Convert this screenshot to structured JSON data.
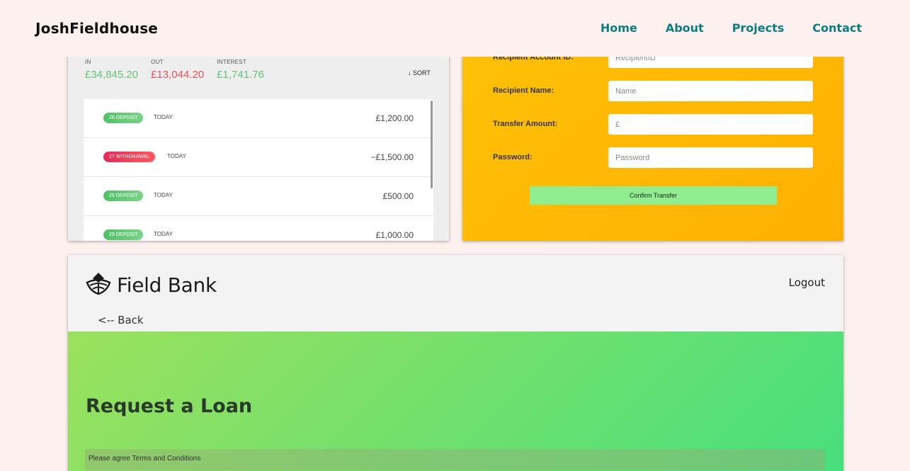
{
  "site": {
    "brand": "JoshFieldhouse",
    "nav": [
      "Home",
      "About",
      "Projects",
      "Contact"
    ],
    "nav_color": "#0a7d82"
  },
  "movements_panel": {
    "summary": {
      "in_label": "IN",
      "in_value": "£34,845.20",
      "out_label": "OUT",
      "out_value": "£13,044.20",
      "interest_label": "INTEREST",
      "interest_value": "£1,741.76"
    },
    "sort_label": "↓ SORT",
    "rows": [
      {
        "badge": "28 DEPOSIT",
        "type": "deposit",
        "date": "TODAY",
        "value": "£1,200.00"
      },
      {
        "badge": "27 WITHDRAWAL",
        "type": "withdrawal",
        "date": "TODAY",
        "value": "−£1,500.00"
      },
      {
        "badge": "26 DEPOSIT",
        "type": "deposit",
        "date": "TODAY",
        "value": "£500.00"
      },
      {
        "badge": "25 DEPOSIT",
        "type": "deposit",
        "date": "TODAY",
        "value": "£1,000.00"
      }
    ],
    "colors": {
      "positive": "#66c27a",
      "negative": "#e5535f"
    }
  },
  "transfer_panel": {
    "fields": [
      {
        "label": "Recipient Account ID:",
        "placeholder": "RecipientID"
      },
      {
        "label": "Recipient Name:",
        "placeholder": "Name"
      },
      {
        "label": "Transfer Amount:",
        "placeholder": "£"
      },
      {
        "label": "Password:",
        "placeholder": "Password"
      }
    ],
    "confirm_label": "Confirm Transfer",
    "accent": "#ffc107"
  },
  "loan_panel": {
    "logo_text": "Field Bank",
    "logout_label": "Logout",
    "back_label": "<-- Back",
    "title": "Request a Loan",
    "terms_label": "Please agree Terms and Conditions"
  }
}
